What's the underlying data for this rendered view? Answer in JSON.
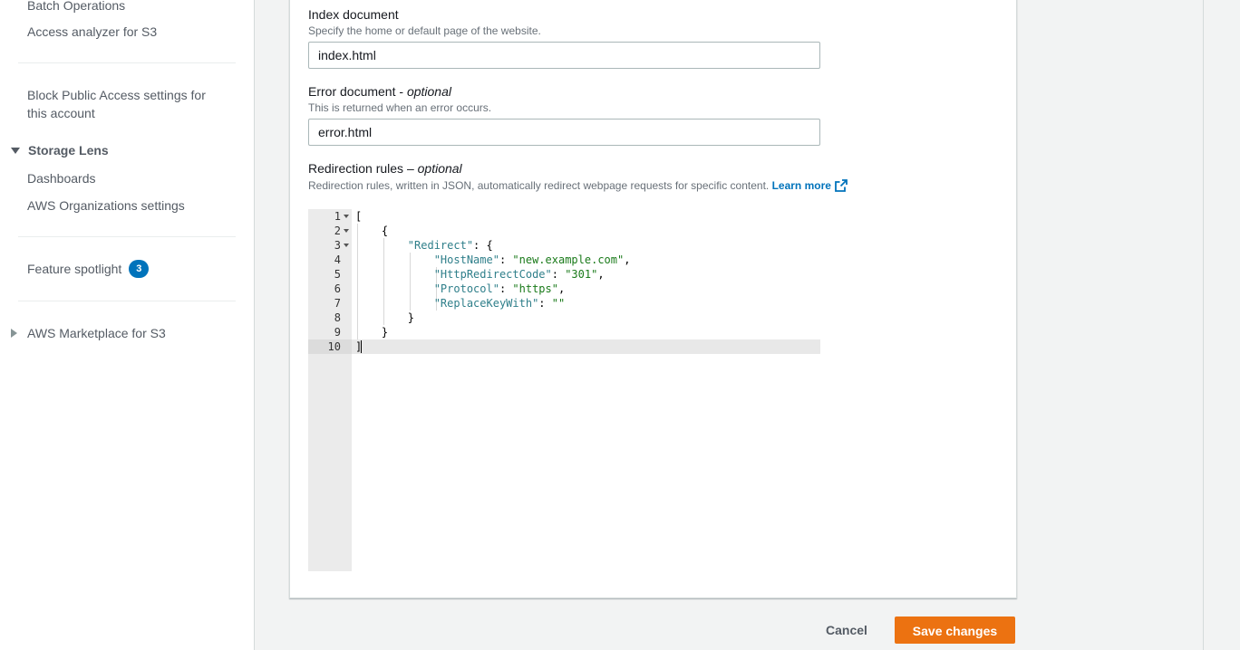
{
  "sidebar": {
    "links_top": [
      {
        "label": "Batch Operations"
      },
      {
        "label": "Access analyzer for S3"
      }
    ],
    "block_public_access": "Block Public Access settings for this account",
    "storage_lens": {
      "heading": "Storage Lens",
      "items": [
        {
          "label": "Dashboards"
        },
        {
          "label": "AWS Organizations settings"
        }
      ]
    },
    "feature_spotlight": {
      "label": "Feature spotlight",
      "badge": "3"
    },
    "marketplace": "AWS Marketplace for S3"
  },
  "form": {
    "index_document": {
      "label": "Index document",
      "description": "Specify the home or default page of the website.",
      "value": "index.html"
    },
    "error_document": {
      "label": "Error document - ",
      "optional": "optional",
      "description": "This is returned when an error occurs.",
      "value": "error.html"
    },
    "redirection_rules": {
      "label": "Redirection rules – ",
      "optional": "optional",
      "description": "Redirection rules, written in JSON, automatically redirect webpage requests for specific content.",
      "learn_more": "Learn more"
    }
  },
  "editor": {
    "line_numbers": [
      "1",
      "2",
      "3",
      "4",
      "5",
      "6",
      "7",
      "8",
      "9",
      "10"
    ],
    "active_line": 10,
    "lines": [
      "[",
      "    {",
      "        \"Redirect\": {",
      "            \"HostName\": \"new.example.com\",",
      "            \"HttpRedirectCode\": \"301\",",
      "            \"Protocol\": \"https\",",
      "            \"ReplaceKeyWith\": \"\"",
      "        }",
      "    }",
      "]"
    ]
  },
  "actions": {
    "cancel": "Cancel",
    "save": "Save changes"
  },
  "colors": {
    "accent": "#ec7211",
    "link": "#0073bb",
    "badge": "#0073bb"
  }
}
